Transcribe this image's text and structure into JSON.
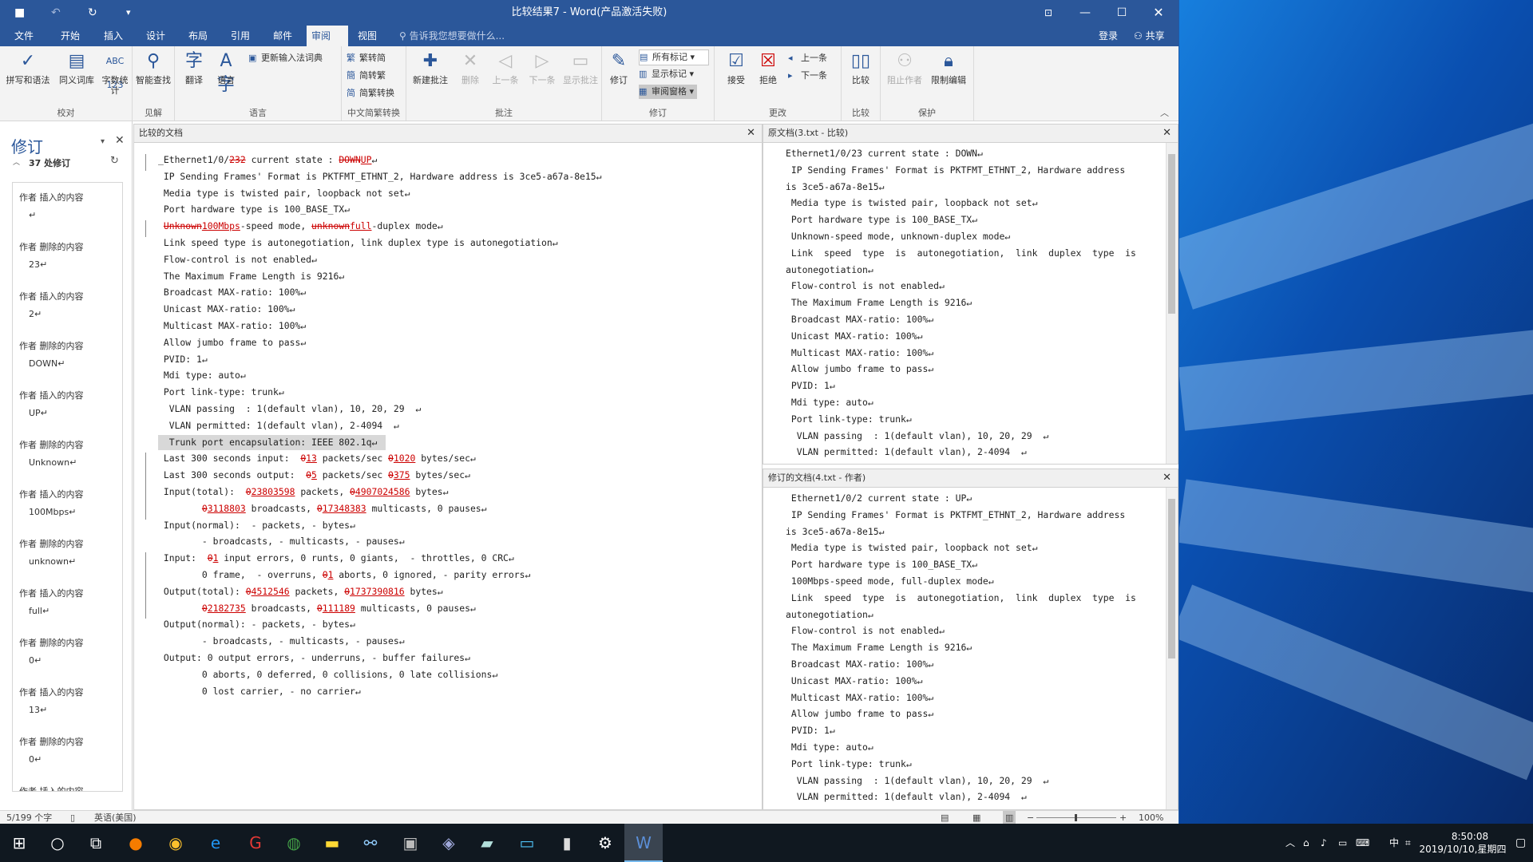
{
  "window": {
    "title": "比较结果7 - Word(产品激活失败)",
    "undo_icon": "↶",
    "redo_icon": "↻",
    "save_icon": "■",
    "customize_icon": "▾"
  },
  "tabs": [
    "文件",
    "开始",
    "插入",
    "设计",
    "布局",
    "引用",
    "邮件",
    "审阅",
    "视图"
  ],
  "active_tab": "审阅",
  "search_placeholder": "告诉我您想要做什么...",
  "account": {
    "login": "登录",
    "share": "共享"
  },
  "ribbon": {
    "groups": {
      "proofing": "校对",
      "insights": "见解",
      "language": "语言",
      "chinese": "中文简繁转换",
      "comments": "批注",
      "tracking": "修订",
      "changes": "更改",
      "compare": "比较",
      "protect": "保护"
    },
    "buttons": {
      "spelling": "拼写和语法",
      "thesaurus": "同义词库",
      "wordcount": "字数统计",
      "smart_lookup": "智能查找",
      "translate": "翻译",
      "language": "语言",
      "update_ime": "更新输入法词典",
      "to_simplified": "繁转简",
      "to_traditional": "简转繁",
      "convert": "简繁转换",
      "new_comment": "新建批注",
      "delete": "删除",
      "previous": "上一条",
      "next": "下一条",
      "show_comments": "显示批注",
      "track": "修订",
      "all_markup": "所有标记",
      "show_markup": "显示标记",
      "reviewing_pane": "审阅窗格",
      "accept": "接受",
      "reject": "拒绝",
      "prev_change": "上一条",
      "next_change": "下一条",
      "compare": "比较",
      "block_authors": "阻止作者",
      "restrict": "限制编辑"
    }
  },
  "revision_panel": {
    "title": "修订",
    "count": "37 处修订",
    "items": [
      {
        "label": "作者  插入的内容",
        "value": "↵"
      },
      {
        "label": "作者  删除的内容",
        "value": "23↵"
      },
      {
        "label": "作者  插入的内容",
        "value": "2↵"
      },
      {
        "label": "作者  删除的内容",
        "value": "DOWN↵"
      },
      {
        "label": "作者  插入的内容",
        "value": "UP↵"
      },
      {
        "label": "作者  删除的内容",
        "value": "Unknown↵"
      },
      {
        "label": "作者  插入的内容",
        "value": "100Mbps↵"
      },
      {
        "label": "作者  删除的内容",
        "value": "unknown↵"
      },
      {
        "label": "作者  插入的内容",
        "value": "full↵"
      },
      {
        "label": "作者  删除的内容",
        "value": "0↵"
      },
      {
        "label": "作者  插入的内容",
        "value": "13↵"
      },
      {
        "label": "作者  删除的内容",
        "value": "0↵"
      },
      {
        "label": "作者  插入的内容",
        "value": ""
      }
    ]
  },
  "compared_doc": {
    "title": "比较的文档",
    "lines": [
      [
        [
          "n",
          "_Ethernet1/0/"
        ],
        [
          "d",
          "232"
        ],
        [
          "n",
          " current state : "
        ],
        [
          "d",
          "DOWN"
        ],
        [
          "i",
          "UP"
        ],
        [
          "n",
          "↵"
        ]
      ],
      [
        [
          "n",
          " IP Sending Frames' Format is PKTFMT_ETHNT_2, Hardware address is 3ce5-a67a-8e15↵"
        ]
      ],
      [
        [
          "n",
          " Media type is twisted pair, loopback not set↵"
        ]
      ],
      [
        [
          "n",
          " Port hardware type is 100_BASE_TX↵"
        ]
      ],
      [
        [
          "n",
          " "
        ],
        [
          "d",
          "Unknown"
        ],
        [
          "i",
          "100Mbps"
        ],
        [
          "n",
          "-speed mode, "
        ],
        [
          "d",
          "unknown"
        ],
        [
          "i",
          "full"
        ],
        [
          "n",
          "-duplex mode↵"
        ]
      ],
      [
        [
          "n",
          " Link speed type is autonegotiation, link duplex type is autonegotiation↵"
        ]
      ],
      [
        [
          "n",
          " Flow-control is not enabled↵"
        ]
      ],
      [
        [
          "n",
          " The Maximum Frame Length is 9216↵"
        ]
      ],
      [
        [
          "n",
          " Broadcast MAX-ratio: 100%↵"
        ]
      ],
      [
        [
          "n",
          " Unicast MAX-ratio: 100%↵"
        ]
      ],
      [
        [
          "n",
          " Multicast MAX-ratio: 100%↵"
        ]
      ],
      [
        [
          "n",
          " Allow jumbo frame to pass↵"
        ]
      ],
      [
        [
          "n",
          " PVID: 1↵"
        ]
      ],
      [
        [
          "n",
          " Mdi type: auto↵"
        ]
      ],
      [
        [
          "n",
          " Port link-type: trunk↵"
        ]
      ],
      [
        [
          "n",
          "  VLAN passing  : 1(default vlan), 10, 20, 29  ↵"
        ]
      ],
      [
        [
          "n",
          "  VLAN permitted: 1(default vlan), 2-4094  ↵"
        ]
      ],
      [
        [
          "n",
          "  Trunk port encapsulation: IEEE 802.1q↵"
        ]
      ],
      [
        [
          "n",
          " Last 300 seconds input:  "
        ],
        [
          "d",
          "0"
        ],
        [
          "i",
          "13"
        ],
        [
          "n",
          " packets/sec "
        ],
        [
          "d",
          "0"
        ],
        [
          "i",
          "1020"
        ],
        [
          "n",
          " bytes/sec↵"
        ]
      ],
      [
        [
          "n",
          " Last 300 seconds output:  "
        ],
        [
          "d",
          "0"
        ],
        [
          "i",
          "5"
        ],
        [
          "n",
          " packets/sec "
        ],
        [
          "d",
          "0"
        ],
        [
          "i",
          "375"
        ],
        [
          "n",
          " bytes/sec↵"
        ]
      ],
      [
        [
          "n",
          " Input(total):  "
        ],
        [
          "d",
          "0"
        ],
        [
          "i",
          "23803598"
        ],
        [
          "n",
          " packets, "
        ],
        [
          "d",
          "0"
        ],
        [
          "i",
          "4907024586"
        ],
        [
          "n",
          " bytes↵"
        ]
      ],
      [
        [
          "n",
          "        "
        ],
        [
          "d",
          "0"
        ],
        [
          "i",
          "3118803"
        ],
        [
          "n",
          " broadcasts, "
        ],
        [
          "d",
          "0"
        ],
        [
          "i",
          "17348383"
        ],
        [
          "n",
          " multicasts, 0 pauses↵"
        ]
      ],
      [
        [
          "n",
          " Input(normal):  - packets, - bytes↵"
        ]
      ],
      [
        [
          "n",
          "        - broadcasts, - multicasts, - pauses↵"
        ]
      ],
      [
        [
          "n",
          " Input:  "
        ],
        [
          "d",
          "0"
        ],
        [
          "i",
          "1"
        ],
        [
          "n",
          " input errors, 0 runts, 0 giants,  - throttles, 0 CRC↵"
        ]
      ],
      [
        [
          "n",
          "        0 frame,  - overruns, "
        ],
        [
          "d",
          "0"
        ],
        [
          "i",
          "1"
        ],
        [
          "n",
          " aborts, 0 ignored, - parity errors↵"
        ]
      ],
      [
        [
          "n",
          " Output(total): "
        ],
        [
          "d",
          "0"
        ],
        [
          "i",
          "4512546"
        ],
        [
          "n",
          " packets, "
        ],
        [
          "d",
          "0"
        ],
        [
          "i",
          "1737390816"
        ],
        [
          "n",
          " bytes↵"
        ]
      ],
      [
        [
          "n",
          "        "
        ],
        [
          "d",
          "0"
        ],
        [
          "i",
          "2182735"
        ],
        [
          "n",
          " broadcasts, "
        ],
        [
          "d",
          "0"
        ],
        [
          "i",
          "111189"
        ],
        [
          "n",
          " multicasts, 0 pauses↵"
        ]
      ],
      [
        [
          "n",
          " Output(normal): - packets, - bytes↵"
        ]
      ],
      [
        [
          "n",
          "        - broadcasts, - multicasts, - pauses↵"
        ]
      ],
      [
        [
          "n",
          " Output: 0 output errors, - underruns, - buffer failures↵"
        ]
      ],
      [
        [
          "n",
          "        0 aborts, 0 deferred, 0 collisions, 0 late collisions↵"
        ]
      ],
      [
        [
          "n",
          "        0 lost carrier, - no carrier↵"
        ]
      ]
    ]
  },
  "original_doc": {
    "title": "原文档(3.txt - 比较)",
    "lines": [
      "Ethernet1/0/23 current state : DOWN↵",
      " IP Sending Frames' Format is PKTFMT_ETHNT_2, Hardware address",
      "is 3ce5-a67a-8e15↵",
      " Media type is twisted pair, loopback not set↵",
      " Port hardware type is 100_BASE_TX↵",
      " Unknown-speed mode, unknown-duplex mode↵",
      " Link  speed  type  is  autonegotiation,  link  duplex  type  is",
      "autonegotiation↵",
      " Flow-control is not enabled↵",
      " The Maximum Frame Length is 9216↵",
      " Broadcast MAX-ratio: 100%↵",
      " Unicast MAX-ratio: 100%↵",
      " Multicast MAX-ratio: 100%↵",
      " Allow jumbo frame to pass↵",
      " PVID: 1↵",
      " Mdi type: auto↵",
      " Port link-type: trunk↵",
      "  VLAN passing  : 1(default vlan), 10, 20, 29  ↵",
      "  VLAN permitted: 1(default vlan), 2-4094  ↵"
    ]
  },
  "revised_doc": {
    "title": "修订的文档(4.txt - 作者)",
    "lines": [
      " Ethernet1/0/2 current state : UP↵",
      " IP Sending Frames' Format is PKTFMT_ETHNT_2, Hardware address",
      "is 3ce5-a67a-8e15↵",
      " Media type is twisted pair, loopback not set↵",
      " Port hardware type is 100_BASE_TX↵",
      " 100Mbps-speed mode, full-duplex mode↵",
      " Link  speed  type  is  autonegotiation,  link  duplex  type  is",
      "autonegotiation↵",
      " Flow-control is not enabled↵",
      " The Maximum Frame Length is 9216↵",
      " Broadcast MAX-ratio: 100%↵",
      " Unicast MAX-ratio: 100%↵",
      " Multicast MAX-ratio: 100%↵",
      " Allow jumbo frame to pass↵",
      " PVID: 1↵",
      " Mdi type: auto↵",
      " Port link-type: trunk↵",
      "  VLAN passing  : 1(default vlan), 10, 20, 29  ↵",
      "  VLAN permitted: 1(default vlan), 2-4094  ↵"
    ]
  },
  "statusbar": {
    "words": "5/199 个字",
    "language": "英语(美国)",
    "zoom": "100%"
  },
  "taskbar": {
    "time": "8:50:08",
    "date": "2019/10/10,星期四",
    "ime": "中"
  },
  "colors": {
    "accent": "#2b579a",
    "revision": "#c00000"
  }
}
